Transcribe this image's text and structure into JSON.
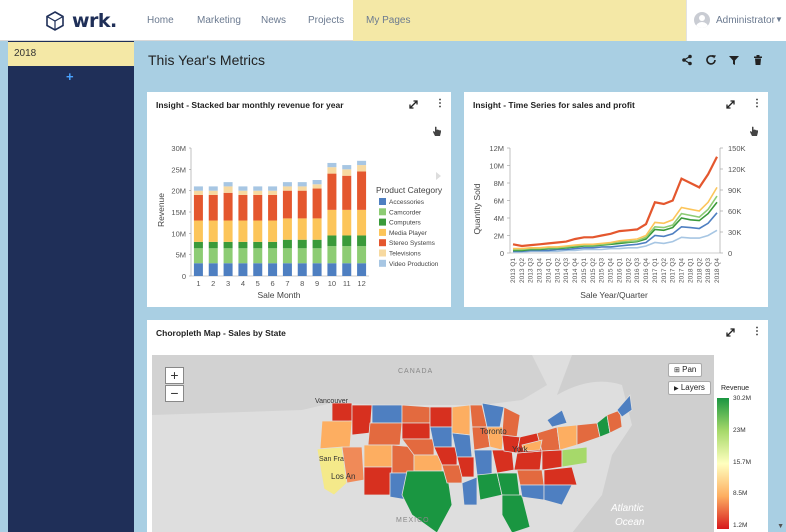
{
  "header": {
    "logo_text": "wrk.",
    "nav": [
      "Home",
      "Marketing",
      "News",
      "Projects",
      "My Pages"
    ],
    "active_nav": "My Pages",
    "user": "Administrator"
  },
  "sidebar": {
    "items": [
      {
        "label": "2018"
      }
    ],
    "add_label": "+"
  },
  "page": {
    "title": "This Year's Metrics",
    "toolbar_icons": [
      "share-icon",
      "refresh-icon",
      "filter-icon",
      "delete-icon"
    ]
  },
  "panels": {
    "bar": {
      "title": "Insight - Stacked bar monthly revenue for year",
      "icons": [
        "expand-icon",
        "more-icon",
        "hand-pointer-icon"
      ]
    },
    "series": {
      "title": "Insight - Time Series for sales and profit",
      "icons": [
        "expand-icon",
        "more-icon",
        "hand-pointer-icon"
      ]
    },
    "map": {
      "title": "Choropleth Map - Sales by State",
      "icons": [
        "expand-icon",
        "more-icon"
      ],
      "zoom_in": "+",
      "zoom_out": "−",
      "pan_label": "Pan",
      "layers_label": "Layers",
      "legend_title": "Revenue",
      "legend_ticks": [
        "30.2M",
        "23M",
        "15.7M",
        "8.5M",
        "1.2M"
      ],
      "legend_colors": [
        "#1a9641",
        "#a6d96a",
        "#ffffbf",
        "#fdae61",
        "#d7191c"
      ],
      "labels": [
        "CANADA",
        "Vancouver",
        "Toronto",
        "San Fra",
        "Los An",
        "York",
        "MEXICO",
        "Atlantic",
        "Ocean"
      ]
    }
  },
  "chart_data": [
    {
      "type": "bar",
      "stacked": true,
      "categories": [
        "1",
        "2",
        "3",
        "4",
        "5",
        "6",
        "7",
        "8",
        "9",
        "10",
        "11",
        "12"
      ],
      "series": [
        {
          "name": "Accessories",
          "color": "#4e7fc1",
          "values": [
            3,
            3,
            3,
            3,
            3,
            3,
            3,
            3,
            3,
            3,
            3,
            3
          ]
        },
        {
          "name": "Camcorder",
          "color": "#8dcc74",
          "values": [
            3.5,
            3.5,
            3.5,
            3.5,
            3.5,
            3.5,
            3.5,
            3.5,
            3.5,
            4,
            4,
            4
          ]
        },
        {
          "name": "Computers",
          "color": "#3a9a3a",
          "values": [
            1.5,
            1.5,
            1.5,
            1.5,
            1.5,
            1.5,
            2,
            2,
            2,
            2.5,
            2.5,
            2.5
          ]
        },
        {
          "name": "Media Player",
          "color": "#fcc55a",
          "values": [
            5,
            5,
            5,
            5,
            5,
            5,
            5,
            5,
            5,
            6,
            6,
            6
          ]
        },
        {
          "name": "Stereo Systems",
          "color": "#e4572e",
          "values": [
            6,
            6,
            6.5,
            6,
            6,
            6,
            6.5,
            6.5,
            7,
            8.5,
            8,
            9
          ]
        },
        {
          "name": "Televisions",
          "color": "#f7d9a0",
          "values": [
            1,
            1,
            1.5,
            1,
            1,
            1,
            1,
            1,
            1,
            1.5,
            1.5,
            1.5
          ]
        },
        {
          "name": "Video Production",
          "color": "#a7c6e3",
          "values": [
            1,
            1,
            1,
            1,
            1,
            1,
            1,
            1,
            1,
            1,
            1,
            1
          ]
        }
      ],
      "xlabel": "Sale Month",
      "ylabel": "Revenue",
      "yticks": [
        "0",
        "5M",
        "10M",
        "15M",
        "20M",
        "25M",
        "30M"
      ],
      "ylim": [
        0,
        30
      ],
      "legend_title": "Product Category",
      "legend_position": "right"
    },
    {
      "type": "line",
      "x": [
        "2013 Q1",
        "2013 Q2",
        "2013 Q3",
        "2013 Q4",
        "2014 Q1",
        "2014 Q2",
        "2014 Q3",
        "2014 Q4",
        "2015 Q1",
        "2015 Q2",
        "2015 Q3",
        "2015 Q4",
        "2016 Q1",
        "2016 Q2",
        "2016 Q3",
        "2016 Q4",
        "2017 Q1",
        "2017 Q2",
        "2017 Q3",
        "2017 Q4",
        "2018 Q1",
        "2018 Q2",
        "2018 Q3",
        "2018 Q4"
      ],
      "series": [
        {
          "color": "#e4572e",
          "values": [
            1,
            0.8,
            0.9,
            1,
            1.1,
            1.2,
            1.3,
            1.6,
            1.8,
            1.8,
            2,
            2.2,
            2.5,
            2.6,
            2.7,
            3.3,
            5.8,
            5.6,
            6,
            8.5,
            8,
            7.5,
            9,
            11
          ]
        },
        {
          "color": "#fcc55a",
          "values": [
            0.5,
            0.5,
            0.6,
            0.6,
            0.7,
            0.7,
            0.8,
            0.9,
            1,
            1,
            1.1,
            1.2,
            1.4,
            1.5,
            1.6,
            2,
            3.5,
            3.4,
            3.8,
            5.2,
            5,
            4.8,
            5.8,
            7.5
          ]
        },
        {
          "color": "#8dcc74",
          "values": [
            0.4,
            0.4,
            0.5,
            0.5,
            0.6,
            0.6,
            0.7,
            0.8,
            0.9,
            0.9,
            1,
            1.1,
            1.3,
            1.3,
            1.4,
            1.8,
            3,
            2.9,
            3.2,
            4.5,
            4.3,
            4.1,
            5,
            6.5
          ]
        },
        {
          "color": "#3a9a3a",
          "values": [
            0.3,
            0.3,
            0.4,
            0.4,
            0.5,
            0.5,
            0.6,
            0.7,
            0.8,
            0.8,
            0.9,
            1,
            1.1,
            1.2,
            1.3,
            1.6,
            2.7,
            2.6,
            2.9,
            4,
            3.8,
            3.7,
            4.5,
            5.8
          ]
        },
        {
          "color": "#4e7fc1",
          "values": [
            0.2,
            0.2,
            0.3,
            0.3,
            0.3,
            0.4,
            0.4,
            0.5,
            0.6,
            0.6,
            0.7,
            0.7,
            0.8,
            0.9,
            1,
            1.2,
            2,
            1.9,
            2.2,
            3,
            2.9,
            2.8,
            3.4,
            4.6
          ]
        },
        {
          "color": "#a7c6e3",
          "values": [
            0.1,
            0.1,
            0.2,
            0.2,
            0.2,
            0.2,
            0.3,
            0.3,
            0.4,
            0.4,
            0.4,
            0.5,
            0.5,
            0.6,
            0.6,
            0.8,
            1.2,
            1.1,
            1.3,
            1.8,
            1.7,
            1.7,
            2,
            2.6
          ]
        }
      ],
      "xlabel": "Sale Year/Quarter",
      "ylabel": "Quantity Sold",
      "yticks_left": [
        "0",
        "2M",
        "4M",
        "6M",
        "8M",
        "10M",
        "12M"
      ],
      "yticks_right": [
        "0",
        "30K",
        "60K",
        "90K",
        "120K",
        "150K"
      ],
      "ylim": [
        0,
        12
      ]
    }
  ]
}
